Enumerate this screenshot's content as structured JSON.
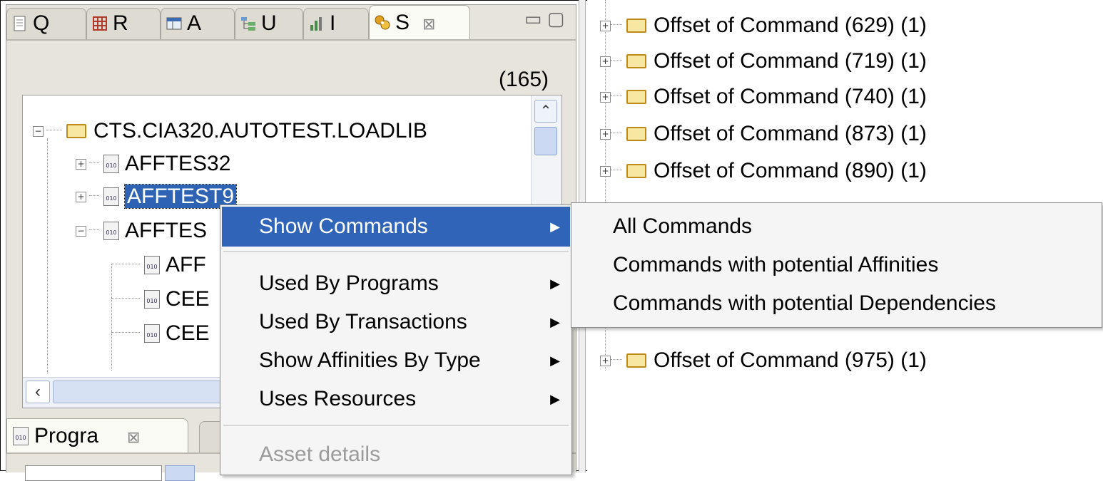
{
  "tabs": [
    {
      "label": "Q",
      "icon": "document-icon"
    },
    {
      "label": "R",
      "icon": "grid-icon"
    },
    {
      "label": "A",
      "icon": "table-icon"
    },
    {
      "label": "U",
      "icon": "tree-icon"
    },
    {
      "label": "I",
      "icon": "chart-icon"
    },
    {
      "label": "S",
      "icon": "network-icon",
      "active": true,
      "close": "⊠"
    }
  ],
  "view_controls": {
    "minimize": "▭",
    "maximize": "▢"
  },
  "count": "(165)",
  "tree": {
    "root": "CTS.CIA320.AUTOTEST.LOADLIB",
    "items": [
      "AFFTES32",
      "AFFTEST9",
      "AFFTES"
    ],
    "children": [
      "AFF",
      "CEE",
      "CEE"
    ]
  },
  "bottom_view": {
    "tab_label": "Progra",
    "close": "⊠"
  },
  "offsets": [
    "Offset of Command (629)  (1)",
    "Offset of Command (719)  (1)",
    "Offset of Command (740)  (1)",
    "Offset of Command (873)  (1)",
    "Offset of Command (890)  (1)",
    "Offset of Command (975)  (1)"
  ],
  "context_menu": {
    "items": [
      {
        "label": "Show Commands",
        "submenu": true,
        "highlighted": true
      },
      {
        "label": "Used By Programs",
        "submenu": true
      },
      {
        "label": "Used By Transactions",
        "submenu": true
      },
      {
        "label": "Show Affinities By Type",
        "submenu": true
      },
      {
        "label": "Uses Resources",
        "submenu": true
      },
      {
        "label": "Asset details",
        "disabled": true
      }
    ]
  },
  "submenu": {
    "items": [
      "All Commands",
      "Commands with potential Affinities",
      "Commands with potential Dependencies"
    ]
  },
  "colors": {
    "highlight": "#3064b8",
    "selection": "#2e63b4",
    "panel_bg": "#e6e4dd"
  }
}
